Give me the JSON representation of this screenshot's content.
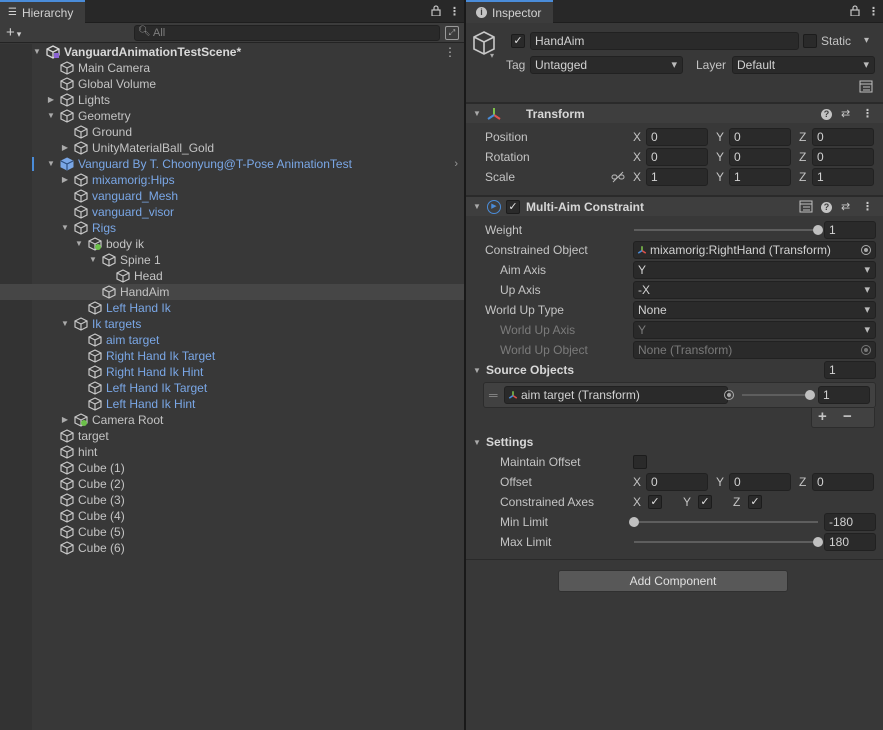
{
  "hierarchy": {
    "tab_label": "Hierarchy",
    "search_placeholder": "All",
    "add_label": "+",
    "rows": [
      {
        "label": "VanguardAnimationTestScene*",
        "kind": "scene",
        "depth": 0,
        "arrow": "open"
      },
      {
        "label": "Main Camera",
        "kind": "cube",
        "depth": 1,
        "arrow": "none"
      },
      {
        "label": "Global Volume",
        "kind": "cube",
        "depth": 1,
        "arrow": "none"
      },
      {
        "label": "Lights",
        "kind": "cube",
        "depth": 1,
        "arrow": "closed"
      },
      {
        "label": "Geometry",
        "kind": "cube",
        "depth": 1,
        "arrow": "open"
      },
      {
        "label": "Ground",
        "kind": "cube",
        "depth": 2,
        "arrow": "none"
      },
      {
        "label": "UnityMaterialBall_Gold",
        "kind": "cube",
        "depth": 2,
        "arrow": "closed"
      },
      {
        "label": "Vanguard By T. Choonyung@T-Pose AnimationTest",
        "kind": "prefab",
        "depth": 1,
        "arrow": "open",
        "blue": true
      },
      {
        "label": "mixamorig:Hips",
        "kind": "cube",
        "depth": 2,
        "arrow": "closed",
        "blue": true
      },
      {
        "label": "vanguard_Mesh",
        "kind": "cube",
        "depth": 2,
        "arrow": "none",
        "blue": true
      },
      {
        "label": "vanguard_visor",
        "kind": "cube",
        "depth": 2,
        "arrow": "none",
        "blue": true
      },
      {
        "label": "Rigs",
        "kind": "cube",
        "depth": 2,
        "arrow": "open",
        "blue": true
      },
      {
        "label": "body ik",
        "kind": "rig",
        "depth": 3,
        "arrow": "open"
      },
      {
        "label": "Spine 1",
        "kind": "cube",
        "depth": 4,
        "arrow": "open"
      },
      {
        "label": "Head",
        "kind": "cube",
        "depth": 5,
        "arrow": "none"
      },
      {
        "label": "HandAim",
        "kind": "cube",
        "depth": 4,
        "arrow": "none",
        "selected": true
      },
      {
        "label": "Left Hand Ik",
        "kind": "cube",
        "depth": 3,
        "arrow": "none",
        "blue": true
      },
      {
        "label": "Ik targets",
        "kind": "cube",
        "depth": 2,
        "arrow": "open",
        "blue": true
      },
      {
        "label": "aim target",
        "kind": "cube",
        "depth": 3,
        "arrow": "none",
        "blue": true
      },
      {
        "label": "Right Hand Ik Target",
        "kind": "cube",
        "depth": 3,
        "arrow": "none",
        "blue": true
      },
      {
        "label": "Right Hand Ik Hint",
        "kind": "cube",
        "depth": 3,
        "arrow": "none",
        "blue": true
      },
      {
        "label": "Left Hand Ik Target",
        "kind": "cube",
        "depth": 3,
        "arrow": "none",
        "blue": true
      },
      {
        "label": "Left Hand Ik Hint",
        "kind": "cube",
        "depth": 3,
        "arrow": "none",
        "blue": true
      },
      {
        "label": "Camera Root",
        "kind": "rig",
        "depth": 2,
        "arrow": "closed"
      },
      {
        "label": "target",
        "kind": "cube",
        "depth": 1,
        "arrow": "none"
      },
      {
        "label": "hint",
        "kind": "cube",
        "depth": 1,
        "arrow": "none"
      },
      {
        "label": "Cube (1)",
        "kind": "cube",
        "depth": 1,
        "arrow": "none"
      },
      {
        "label": "Cube (2)",
        "kind": "cube",
        "depth": 1,
        "arrow": "none"
      },
      {
        "label": "Cube (3)",
        "kind": "cube",
        "depth": 1,
        "arrow": "none"
      },
      {
        "label": "Cube (4)",
        "kind": "cube",
        "depth": 1,
        "arrow": "none"
      },
      {
        "label": "Cube (5)",
        "kind": "cube",
        "depth": 1,
        "arrow": "none"
      },
      {
        "label": "Cube (6)",
        "kind": "cube",
        "depth": 1,
        "arrow": "none"
      }
    ]
  },
  "inspector": {
    "tab_label": "Inspector",
    "object_name": "HandAim",
    "static_label": "Static",
    "tag_label": "Tag",
    "tag_value": "Untagged",
    "layer_label": "Layer",
    "layer_value": "Default",
    "transform": {
      "title": "Transform",
      "position_label": "Position",
      "rotation_label": "Rotation",
      "scale_label": "Scale",
      "axis_x": "X",
      "axis_y": "Y",
      "axis_z": "Z",
      "position": [
        "0",
        "0",
        "0"
      ],
      "rotation": [
        "0",
        "0",
        "0"
      ],
      "scale": [
        "1",
        "1",
        "1"
      ]
    },
    "constraint": {
      "title": "Multi-Aim Constraint",
      "weight_label": "Weight",
      "weight_value": "1",
      "weight_fraction": 1,
      "constrained_object_label": "Constrained Object",
      "constrained_object_value": "mixamorig:RightHand (Transform)",
      "aim_axis_label": "Aim Axis",
      "aim_axis_value": "Y",
      "up_axis_label": "Up Axis",
      "up_axis_value": "-X",
      "world_up_type_label": "World Up Type",
      "world_up_type_value": "None",
      "world_up_axis_label": "World Up Axis",
      "world_up_axis_value": "Y",
      "world_up_object_label": "World Up Object",
      "world_up_object_value": "None (Transform)",
      "source_objects_label": "Source Objects",
      "source_objects_count": "1",
      "source_object_value": "aim target (Transform)",
      "source_weight_value": "1",
      "source_weight_fraction": 1,
      "add_label": "+",
      "remove_label": "−"
    },
    "settings": {
      "title": "Settings",
      "maintain_offset_label": "Maintain Offset",
      "offset_label": "Offset",
      "offset": [
        "0",
        "0",
        "0"
      ],
      "constrained_axes_label": "Constrained Axes",
      "min_limit_label": "Min Limit",
      "min_limit_value": "-180",
      "min_limit_fraction": 0,
      "max_limit_label": "Max Limit",
      "max_limit_value": "180",
      "max_limit_fraction": 1
    },
    "add_component_label": "Add Component"
  },
  "colors": {
    "selection_tab": "#4a8cd9",
    "prefab_text": "#7aa7e6",
    "panel_bg": "#383838"
  }
}
